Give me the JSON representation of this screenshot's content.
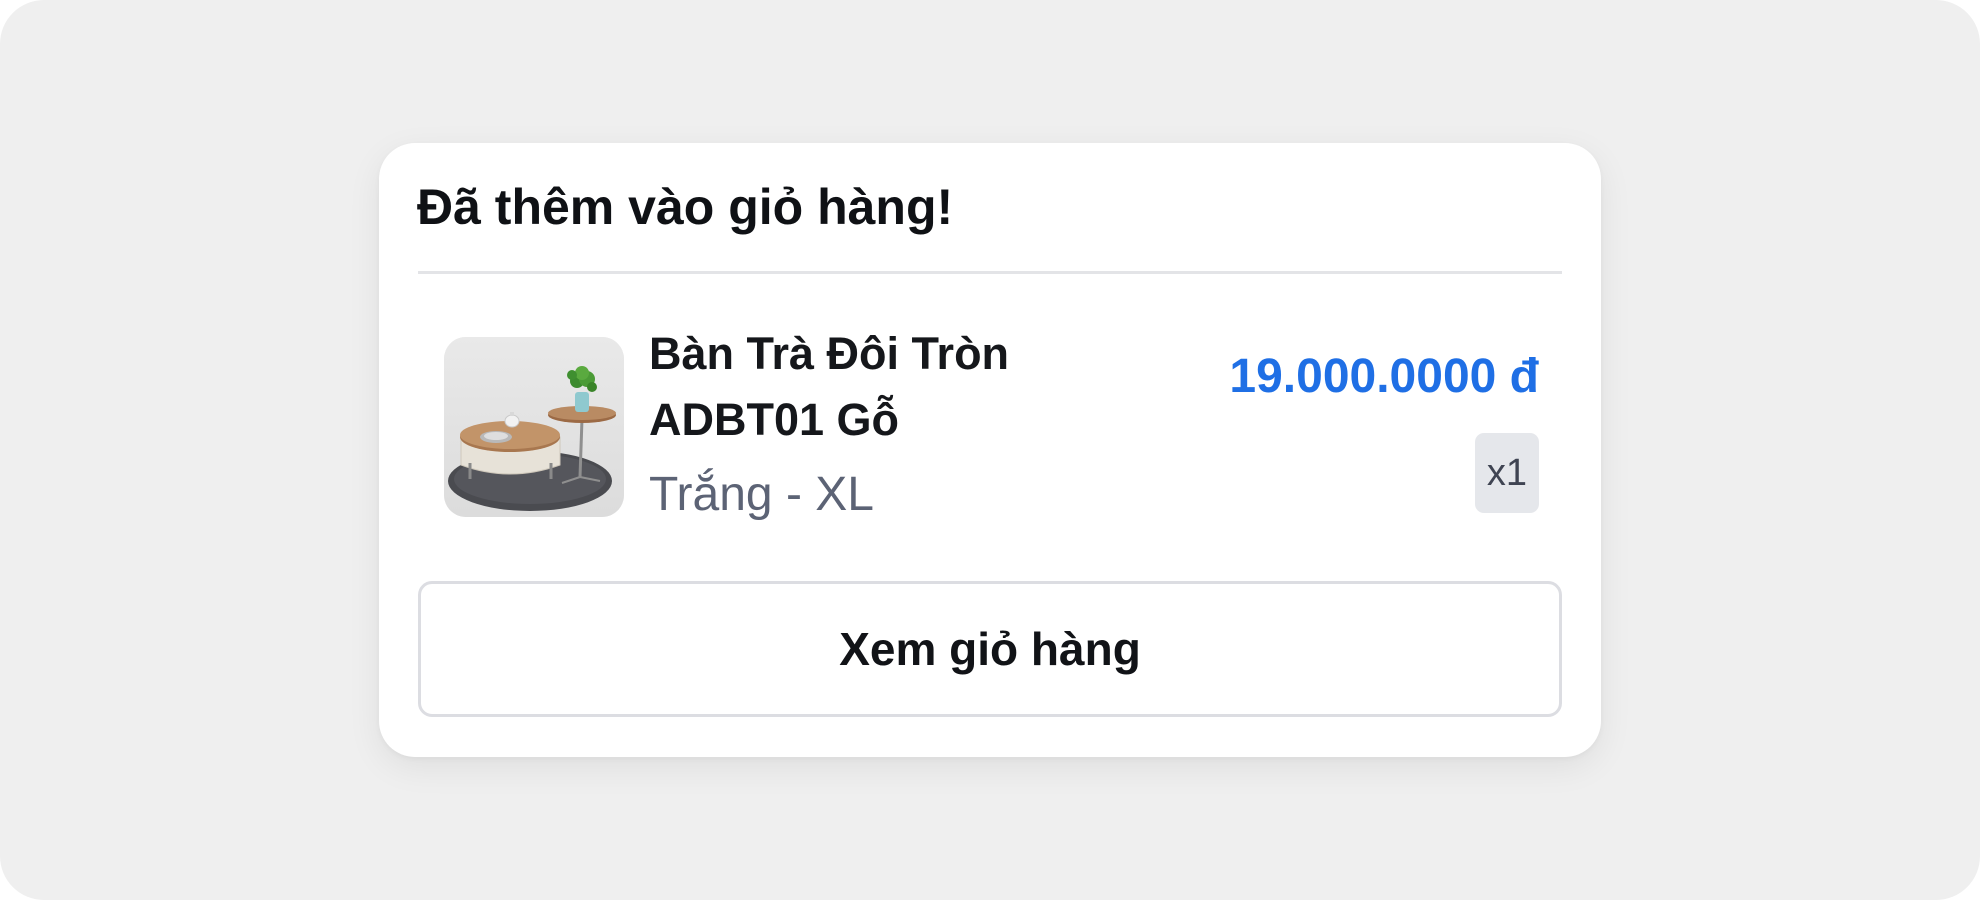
{
  "toast": {
    "title": "Đã thêm vào giỏ hàng!"
  },
  "item": {
    "name": "Bàn Trà Đôi Tròn ADBT01 Gỗ",
    "variant": "Trắng - XL",
    "price": "19.000.0000 đ",
    "quantity": "x1",
    "image_icon": "product-photo-coffee-tables"
  },
  "actions": {
    "view_cart": "Xem giỏ hàng"
  },
  "colors": {
    "page_background": "#efefef",
    "card_background": "#ffffff",
    "price": "#1f6fe5",
    "variant_text": "#5c6375",
    "badge_background": "#e5e7eb",
    "divider": "#e3e4e7"
  }
}
